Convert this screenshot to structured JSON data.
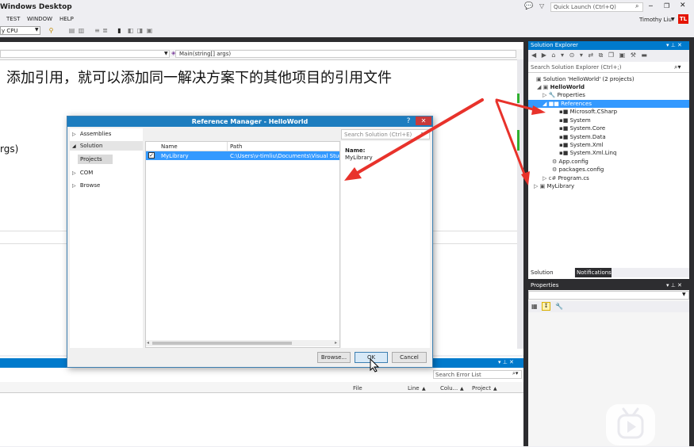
{
  "window": {
    "title": "Windows Desktop"
  },
  "menu": [
    "TEST",
    "WINDOW",
    "HELP"
  ],
  "toolbar": {
    "platform": "y CPU"
  },
  "quick_launch": {
    "placeholder": "Quick Launch (Ctrl+Q)"
  },
  "user": {
    "name": "Timothy Liu",
    "initials": "TL"
  },
  "editor": {
    "member_combo": "Main(string[] args)",
    "annotation": "添加引用，就可以添加同一解决方案下的其他项目的引用文件",
    "code_fragment": "rgs)"
  },
  "dialog": {
    "title": "Reference Manager - HelloWorld",
    "help": "?",
    "close": "✕",
    "nav": [
      {
        "label": "Assemblies",
        "arrow": "▷"
      },
      {
        "label": "Solution",
        "arrow": "◢"
      },
      {
        "label": "Projects",
        "arrow": ""
      },
      {
        "label": "COM",
        "arrow": "▷"
      },
      {
        "label": "Browse",
        "arrow": "▷"
      }
    ],
    "search_placeholder": "Search Solution (Ctrl+E)",
    "columns": [
      "Name",
      "Path"
    ],
    "rows": [
      {
        "name": "MyLibrary",
        "path": "C:\\Users\\v-timliu\\Documents\\Visual Studio 2013",
        "checked": true
      }
    ],
    "detail_label": "Name:",
    "detail_value": "MyLibrary",
    "buttons": {
      "browse": "Browse...",
      "ok": "OK",
      "cancel": "Cancel"
    }
  },
  "solution_explorer": {
    "title": "Solution Explorer",
    "search_placeholder": "Search Solution Explorer (Ctrl+;)",
    "tree": [
      {
        "label": "Solution 'HelloWorld' (2 projects)",
        "icon": "▣",
        "bold": false
      },
      {
        "label": "HelloWorld",
        "icon": "◢ ▣",
        "bold": true
      },
      {
        "label": "Properties",
        "icon": "▷ 🔧",
        "bold": false
      },
      {
        "label": "References",
        "icon": "◢ ■■",
        "bold": false
      },
      {
        "label": "Microsoft.CSharp",
        "icon": "▪■",
        "bold": false
      },
      {
        "label": "System",
        "icon": "▪■",
        "bold": false
      },
      {
        "label": "System.Core",
        "icon": "▪■",
        "bold": false
      },
      {
        "label": "System.Data",
        "icon": "▪■",
        "bold": false
      },
      {
        "label": "System.Xml",
        "icon": "▪■",
        "bold": false
      },
      {
        "label": "System.Xml.Linq",
        "icon": "▪■",
        "bold": false
      },
      {
        "label": "App.config",
        "icon": "⚙",
        "bold": false
      },
      {
        "label": "packages.config",
        "icon": "⚙",
        "bold": false
      },
      {
        "label": "Program.cs",
        "icon": "▷ c#",
        "bold": false
      },
      {
        "label": "MyLibrary",
        "icon": "▷ ▣",
        "bold": false
      }
    ],
    "tabs": [
      "Solution Explorer",
      "Notifications"
    ]
  },
  "properties": {
    "title": "Properties"
  },
  "error_list": {
    "search_placeholder": "Search Error List",
    "columns": [
      "File",
      "Line",
      "Colu...",
      "Project"
    ]
  },
  "colors": {
    "accent": "#007acc",
    "selection": "#3399ff",
    "arrow": "#e8322b",
    "dialog_title": "#1d7dbf"
  }
}
